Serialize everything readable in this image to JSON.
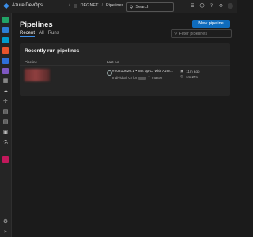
{
  "topbar": {
    "brand_name": "Azure DevOps",
    "crumbs": [
      "DEGNET",
      "Pipelines"
    ],
    "search_label": "Search",
    "icons": [
      "list-icon",
      "bag-icon",
      "help-icon",
      "settings-icon",
      "avatar"
    ]
  },
  "sidebar": {
    "items": [
      {
        "name": "sidebar-item-add",
        "color": "#21a366"
      },
      {
        "name": "sidebar-item-overview",
        "color": "#2c7fd4"
      },
      {
        "name": "sidebar-item-boards",
        "color": "#009ccc"
      },
      {
        "name": "sidebar-item-repos",
        "color": "#e8542c"
      },
      {
        "name": "sidebar-item-pipelines",
        "color": "#2f6fd8"
      },
      {
        "name": "sidebar-item-analytics",
        "color": "#7e57c2"
      },
      {
        "name": "sidebar-item-artifacts",
        "color": "#c2185b"
      }
    ]
  },
  "main": {
    "title": "Pipelines",
    "new_pipeline_label": "New pipeline",
    "tabs": [
      {
        "label": "Recent",
        "active": true
      },
      {
        "label": "All",
        "active": false
      },
      {
        "label": "Runs",
        "active": false
      }
    ],
    "filter_placeholder": "Filter pipelines"
  },
  "card": {
    "title": "Recently run pipelines",
    "columns": [
      "Pipeline",
      "Last run"
    ],
    "row": {
      "run_title": "#20210620.1 • Set up CI with Azur...",
      "run_prefix": "Individual CI for",
      "branch": "master",
      "time_ago": "11m ago",
      "duration": "1m 27s"
    }
  },
  "colors": {
    "accent": "#0f6cbd",
    "background": "#1b1b1b",
    "card": "#252525"
  }
}
